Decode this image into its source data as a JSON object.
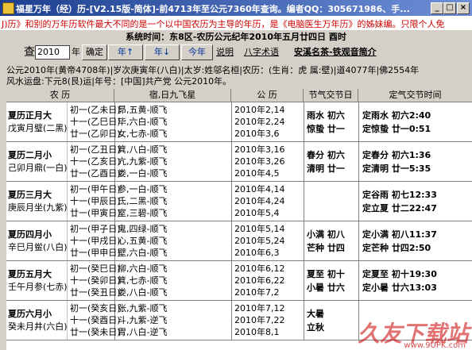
{
  "window": {
    "title": "福星万年（经）历-[V2.15版-简体]-前4713年至公元7360年查询。编者QQ：305671986、手...",
    "minimize": "_",
    "maximize": "□",
    "close": "×"
  },
  "marquee": "J)历》和别的万年历软件最大不同的是一个以中国农历为主导的年历，是《电脑医生万年历》的姊妹编。只限个人免",
  "system_time": "系统时间：东8区-农历公元纪年2010年五月廿四日  酉时",
  "toolbar": {
    "query_label": "查",
    "year_value": "2010",
    "year_unit": "年",
    "confirm": "确定",
    "year_up": "年↑",
    "year_down": "年↓",
    "today": "今年",
    "explain": "说明",
    "bazi": "八字术语",
    "anqi": "安溪名茶-铁观音简介"
  },
  "info": {
    "line1": "公元2010年(黄帝4708年)|岁次庚寅年(八白)|太岁:姓邬名桓|农历：(生肖：虎 属:壁)|道4077年|佛2554年",
    "line2": "风水运盘:下元8(艮)运|年号：[中国]共产党  公元2010年。"
  },
  "grid": {
    "headers": [
      "农 历",
      "宿,日九飞星",
      "公 历",
      "节气交节日",
      "定气交节时间"
    ],
    "months": [
      {
        "name1": "夏历正月大",
        "name2": "戊寅月璧(二黑)",
        "days": [
          {
            "nong": "初一(乙未日)",
            "xiu": "昴,五黄-顺飞",
            "gong": "2010年2,14"
          },
          {
            "nong": "十一(乙巳日)",
            "xiu": "毕,六白-顺飞",
            "gong": "2010年2,24"
          },
          {
            "nong": "廿一(乙卯日)",
            "xiu": "女,七赤-顺飞",
            "gong": "2010年3,6"
          }
        ],
        "jie": [
          "雨水 初六",
          "惊蛰 廿一"
        ],
        "time": [
          "定雨水 初六2:40",
          "定惊蛰 廿一0:51"
        ]
      },
      {
        "name1": "夏历二月小",
        "name2": "己卯月鼎(一白)",
        "days": [
          {
            "nong": "初一(乙丑日)",
            "xiu": "箕,八白-顺飞",
            "gong": "2010年3,16"
          },
          {
            "nong": "十一(乙亥日)",
            "xiu": "亢,九紫-顺飞",
            "gong": "2010年3,26"
          },
          {
            "nong": "廿一(乙酉日)",
            "xiu": "娄,一白-顺飞",
            "gong": "2010年4,5"
          }
        ],
        "jie": [
          "春分 初六",
          "清明 廿一"
        ],
        "time": [
          "定春分 初六1:36",
          "定清明 廿一5:35"
        ]
      },
      {
        "name1": "夏历三月大",
        "name2": "庚辰月坐(九紫)",
        "days": [
          {
            "nong": "初一(甲午日)",
            "xiu": "参,一白-顺飞",
            "gong": "2010年4,14"
          },
          {
            "nong": "十一(甲辰日)",
            "xiu": "氐,二黑-顺飞",
            "gong": "2010年4,24"
          },
          {
            "nong": "廿一(甲寅日)",
            "xiu": "室,三碧-顺飞",
            "gong": "2010年5,4"
          }
        ],
        "jie": [
          "",
          ""
        ],
        "time": [
          "定谷雨 初七12:33",
          "定立夏 廿二22:47"
        ]
      },
      {
        "name1": "夏历四月小",
        "name2": "辛巳月鲎(八白)",
        "days": [
          {
            "nong": "初一(甲子日)",
            "xiu": "鬼,四绿-顺飞",
            "gong": "2010年5,14"
          },
          {
            "nong": "十一(甲戌日)",
            "xiu": "心,五黄-顺飞",
            "gong": "2010年5,24"
          },
          {
            "nong": "廿一(甲申日)",
            "xiu": "壁,六白-顺飞",
            "gong": "2010年6,3"
          }
        ],
        "jie": [
          "小满 初八",
          "芒种 廿四"
        ],
        "time": [
          "定小满 初八11:37",
          "定芒种 廿四2:50"
        ]
      },
      {
        "name1": "夏历五月大",
        "name2": "壬午月参(七赤)",
        "days": [
          {
            "nong": "初一(癸巳日)",
            "xiu": "柳,六白-顺飞",
            "gong": "2010年6,12"
          },
          {
            "nong": "十一(癸卯日)",
            "xiu": "箕,七赤-顺飞",
            "gong": "2010年6,22"
          },
          {
            "nong": "廿一(癸丑日)",
            "xiu": "娄,八白-顺飞",
            "gong": "2010年7,2"
          }
        ],
        "jie": [
          "夏至 初十",
          "小暑 廿六"
        ],
        "time": [
          "定夏至 初十19:30",
          "定小暑 廿六13:03"
        ]
      },
      {
        "name1": "夏历六月小",
        "name2": "癸未月井(六白)",
        "days": [
          {
            "nong": "初一(癸亥日)",
            "xiu": "张,九紫-顺飞",
            "gong": "2010年7,12"
          },
          {
            "nong": "十一(癸酉日)",
            "xiu": "斗,九紫-逆飞",
            "gong": "2010年7,22"
          },
          {
            "nong": "廿一(癸未日)",
            "xiu": "胃,八白-逆飞",
            "gong": "2010年8,1"
          }
        ],
        "jie": [
          "大暑",
          "立秋"
        ],
        "time": [
          "",
          ""
        ]
      }
    ]
  },
  "watermark": {
    "text": "久友下载站",
    "url": "www.9UPK.com"
  }
}
